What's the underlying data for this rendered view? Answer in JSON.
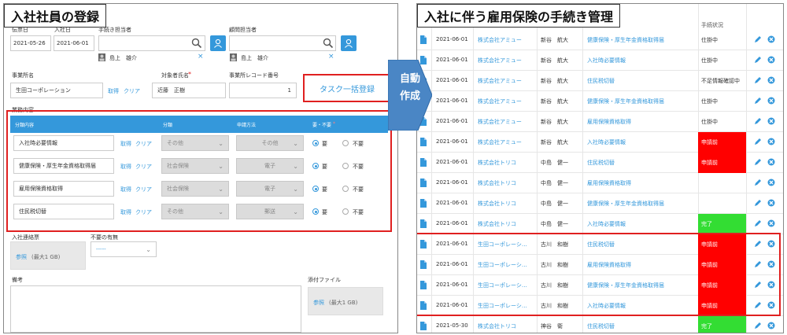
{
  "left": {
    "title": "入社社員の登録",
    "labels": {
      "entry_date_label": "伝票日",
      "join_date_label": "入社日",
      "procedure_owner_label": "手続き担当者",
      "advisor_owner_label": "顧問担当者",
      "office_name_label": "事業所名",
      "target_name_label": "対象者氏名",
      "target_required_mark": "*",
      "office_record_label": "事業所レコード番号",
      "task_content_label": "業務内容",
      "join_contact_label": "入社連絡票",
      "no_need_label": "不要の有無",
      "remarks_label": "備考",
      "attachment_label": "添付ファイル"
    },
    "fields": {
      "entry_date": "2021-05-26",
      "join_date": "2021-06-01",
      "procedure_user": "島上　雄介",
      "advisor_user": "島上　雄介",
      "office_name": "生田コーポレーション",
      "office_get": "取得",
      "office_clear": "クリア",
      "target_name": "近藤　正樹",
      "office_record_no": "1",
      "no_need_select": "-----",
      "contact_ref": "参照",
      "contact_max": "(最大1 GB)",
      "attach_ref": "参照",
      "attach_max": "(最大1 GB)"
    },
    "task_button": "タスク一括登録",
    "table": {
      "headers": [
        "分類内容",
        "分類",
        "申請方法",
        "要・不要"
      ],
      "required_mark": "*",
      "get_label": "取得",
      "clear_label": "クリア",
      "need_label": "要",
      "noneed_label": "不要",
      "rows": [
        {
          "content": "入社時必要情報",
          "category": "その他",
          "method": "その他"
        },
        {
          "content": "健康保険・厚生年金資格取得届",
          "category": "社会保険",
          "method": "電子"
        },
        {
          "content": "雇用保険資格取得",
          "category": "社会保険",
          "method": "電子"
        },
        {
          "content": "住民税切替",
          "category": "その他",
          "method": "郵送"
        }
      ]
    }
  },
  "arrow": {
    "line1": "自動",
    "line2": "作成"
  },
  "right": {
    "title": "入社に伴う雇用保険の手続き管理",
    "status_header": "手続状況",
    "rows": [
      {
        "date": "2021-06-01",
        "company": "株式会社アミュー",
        "person": "新谷　航大",
        "task": "健康保険・厚生年金資格取得届",
        "status": "仕掛中",
        "color": "none"
      },
      {
        "date": "2021-06-01",
        "company": "株式会社アミュー",
        "person": "新谷　航大",
        "task": "入社時必要情報",
        "status": "仕掛中",
        "color": "none"
      },
      {
        "date": "2021-06-01",
        "company": "株式会社アミュー",
        "person": "新谷　航大",
        "task": "住民税切替",
        "status": "不足情報確認中",
        "color": "none"
      },
      {
        "date": "2021-06-01",
        "company": "株式会社アミュー",
        "person": "新谷　航大",
        "task": "健康保険・厚生年金資格取得届",
        "status": "仕掛中",
        "color": "none"
      },
      {
        "date": "2021-06-01",
        "company": "株式会社アミュー",
        "person": "新谷　航大",
        "task": "雇用保険資格取得",
        "status": "仕掛中",
        "color": "none"
      },
      {
        "date": "2021-06-01",
        "company": "株式会社アミュー",
        "person": "新谷　航大",
        "task": "入社時必要情報",
        "status": "申請前",
        "color": "#ff0000"
      },
      {
        "date": "2021-06-01",
        "company": "株式会社トリコ",
        "person": "中島　健一",
        "task": "住民税切替",
        "status": "申請前",
        "color": "#ff0000"
      },
      {
        "date": "2021-06-01",
        "company": "株式会社トリコ",
        "person": "中島　健一",
        "task": "雇用保険資格取得",
        "status": "",
        "color": "none"
      },
      {
        "date": "2021-06-01",
        "company": "株式会社トリコ",
        "person": "中島　健一",
        "task": "健康保険・厚生年金資格取得届",
        "status": "",
        "color": "none"
      },
      {
        "date": "2021-06-01",
        "company": "株式会社トリコ",
        "person": "中島　健一",
        "task": "入社時必要情報",
        "status": "完了",
        "color": "#33dd33"
      },
      {
        "date": "2021-06-01",
        "company": "生田コーポレーシ…",
        "person": "古川　和樹",
        "task": "住民税切替",
        "status": "申請前",
        "color": "#ff0000"
      },
      {
        "date": "2021-06-01",
        "company": "生田コーポレーシ…",
        "person": "古川　和樹",
        "task": "雇用保険資格取得",
        "status": "申請前",
        "color": "#ff0000"
      },
      {
        "date": "2021-06-01",
        "company": "生田コーポレーシ…",
        "person": "古川　和樹",
        "task": "健康保険・厚生年金資格取得届",
        "status": "申請前",
        "color": "#ff0000"
      },
      {
        "date": "2021-06-01",
        "company": "生田コーポレーシ…",
        "person": "古川　和樹",
        "task": "入社時必要情報",
        "status": "申請前",
        "color": "#ff0000"
      },
      {
        "date": "2021-05-30",
        "company": "株式会社トリコ",
        "person": "神谷　衛",
        "task": "住民税切替",
        "status": "完了",
        "color": "#33dd33"
      }
    ]
  },
  "colors": {
    "accent": "#3498db",
    "highlight": "#e02020",
    "status_red": "#ff0000",
    "status_green": "#33dd33"
  }
}
